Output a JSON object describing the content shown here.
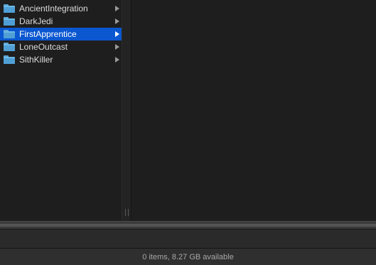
{
  "browser": {
    "column1": {
      "items": [
        {
          "label": "AncientIntegration",
          "icon": "folder-icon",
          "selected": false
        },
        {
          "label": "DarkJedi",
          "icon": "folder-icon",
          "selected": false
        },
        {
          "label": "FirstApprentice",
          "icon": "folder-icon",
          "selected": true
        },
        {
          "label": "LoneOutcast",
          "icon": "folder-icon",
          "selected": false
        },
        {
          "label": "SithKiller",
          "icon": "folder-icon",
          "selected": false
        }
      ]
    },
    "column2": {
      "items": []
    }
  },
  "status": {
    "text": "0 items, 8.27 GB available"
  },
  "colors": {
    "selection": "#0b57d0",
    "folder": "#6cb8e6",
    "background": "#1e1e1e"
  }
}
